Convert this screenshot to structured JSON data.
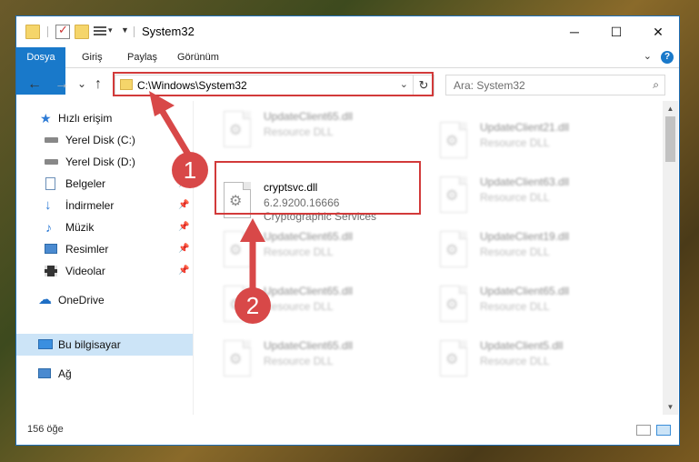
{
  "window": {
    "title": "System32",
    "controls": {
      "minimize": "─",
      "maximize": "☐",
      "close": "✕"
    }
  },
  "ribbon": {
    "tabs": [
      "Dosya",
      "Giriş",
      "Paylaş",
      "Görünüm"
    ],
    "help": "?"
  },
  "navigation": {
    "back": "←",
    "forward": "→",
    "recent": "⌄",
    "up": "↑",
    "address": "C:\\Windows\\System32",
    "refresh": "↻",
    "search_placeholder": "Ara: System32"
  },
  "sidebar": {
    "items": [
      {
        "label": "Hızlı erişim",
        "icon": "star-icon"
      },
      {
        "label": "Yerel Disk (C:)",
        "icon": "drive-icon",
        "pinned": true
      },
      {
        "label": "Yerel Disk (D:)",
        "icon": "drive-icon",
        "pinned": true
      },
      {
        "label": "Belgeler",
        "icon": "document-icon",
        "pinned": true
      },
      {
        "label": "İndirmeler",
        "icon": "download-icon",
        "pinned": true
      },
      {
        "label": "Müzik",
        "icon": "music-icon",
        "pinned": true
      },
      {
        "label": "Resimler",
        "icon": "pictures-icon",
        "pinned": true
      },
      {
        "label": "Videolar",
        "icon": "video-icon",
        "pinned": true
      },
      {
        "label": "OneDrive",
        "icon": "cloud-icon"
      },
      {
        "label": "Bu bilgisayar",
        "icon": "computer-icon",
        "selected": true
      },
      {
        "label": "Ağ",
        "icon": "network-icon"
      }
    ]
  },
  "files": {
    "highlighted": {
      "name": "cryptsvc.dll",
      "version": "6.2.9200.16666",
      "description": "Cryptographic Services"
    },
    "left_column": [
      {
        "name": "UpdateClient65.dll",
        "type": "Resource DLL"
      },
      {
        "name": "UpdateClient65.dll",
        "type": "Resource DLL"
      },
      {
        "name": "UpdateClient65.dll",
        "type": "Resource DLL"
      },
      {
        "name": "UpdateClient65.dll",
        "type": "Resource DLL"
      }
    ],
    "right_column": [
      {
        "name": "UpdateClient21.dll",
        "type": "Resource DLL"
      },
      {
        "name": "UpdateClient63.dll",
        "type": "Resource DLL"
      },
      {
        "name": "UpdateClient19.dll",
        "type": "Resource DLL"
      },
      {
        "name": "UpdateClient65.dll",
        "type": "Resource DLL"
      },
      {
        "name": "UpdateClient5.dll",
        "type": "Resource DLL"
      }
    ]
  },
  "status": {
    "item_count": "156 öğe"
  },
  "annotations": {
    "step1": "1",
    "step2": "2",
    "color": "#d84848"
  }
}
